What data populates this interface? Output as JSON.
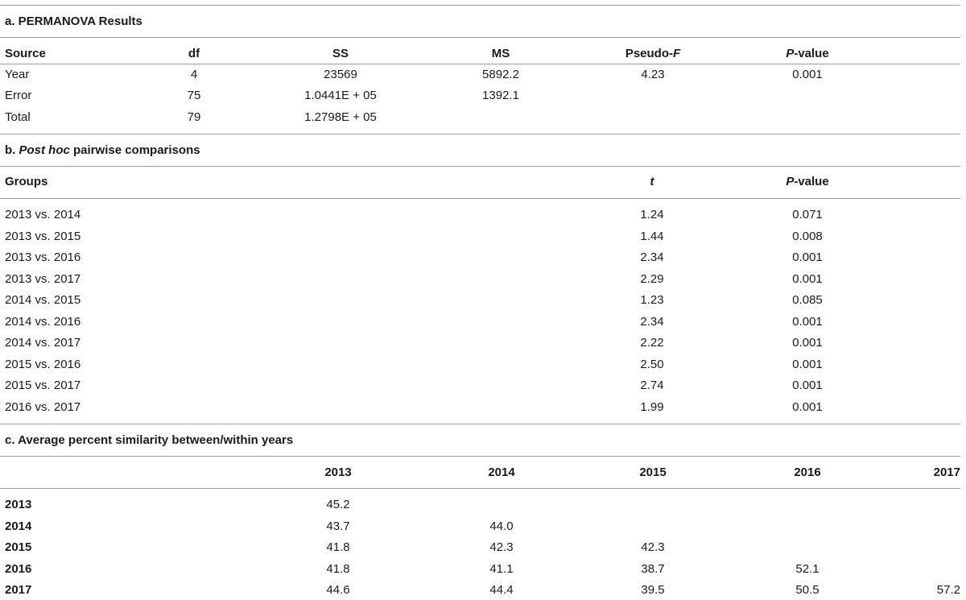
{
  "section_a": {
    "title": "a. PERMANOVA Results",
    "headers": {
      "source": "Source",
      "df": "df",
      "ss": "SS",
      "ms": "MS",
      "pseudo_f_prefix": "Pseudo-",
      "pseudo_f_italic": "F",
      "p_italic": "P",
      "p_suffix": "-value"
    },
    "rows": [
      {
        "source": "Year",
        "df": "4",
        "ss": "23569",
        "ms": "5892.2",
        "pseudo_f": "4.23",
        "p": "0.001"
      },
      {
        "source": "Error",
        "df": "75",
        "ss": "1.0441E + 05",
        "ms": "1392.1",
        "pseudo_f": "",
        "p": ""
      },
      {
        "source": "Total",
        "df": "79",
        "ss": "1.2798E + 05",
        "ms": "",
        "pseudo_f": "",
        "p": ""
      }
    ]
  },
  "section_b": {
    "title_prefix": "b. ",
    "title_italic": "Post hoc",
    "title_suffix": " pairwise comparisons",
    "headers": {
      "groups": "Groups",
      "t": "t",
      "p_italic": "P",
      "p_suffix": "-value"
    },
    "rows": [
      {
        "groups": "2013 vs. 2014",
        "t": "1.24",
        "p": "0.071"
      },
      {
        "groups": "2013 vs. 2015",
        "t": "1.44",
        "p": "0.008"
      },
      {
        "groups": "2013 vs. 2016",
        "t": "2.34",
        "p": "0.001"
      },
      {
        "groups": "2013 vs. 2017",
        "t": "2.29",
        "p": "0.001"
      },
      {
        "groups": "2014 vs. 2015",
        "t": "1.23",
        "p": "0.085"
      },
      {
        "groups": "2014 vs. 2016",
        "t": "2.34",
        "p": "0.001"
      },
      {
        "groups": "2014 vs. 2017",
        "t": "2.22",
        "p": "0.001"
      },
      {
        "groups": "2015 vs. 2016",
        "t": "2.50",
        "p": "0.001"
      },
      {
        "groups": "2015 vs. 2017",
        "t": "2.74",
        "p": "0.001"
      },
      {
        "groups": "2016 vs. 2017",
        "t": "1.99",
        "p": "0.001"
      }
    ]
  },
  "section_c": {
    "title": "c. Average percent similarity between/within years",
    "headers": [
      "2013",
      "2014",
      "2015",
      "2016",
      "2017"
    ],
    "rows": [
      {
        "label": "2013",
        "values": [
          "45.2",
          "",
          "",
          "",
          ""
        ]
      },
      {
        "label": "2014",
        "values": [
          "43.7",
          "44.0",
          "",
          "",
          ""
        ]
      },
      {
        "label": "2015",
        "values": [
          "41.8",
          "42.3",
          "42.3",
          "",
          ""
        ]
      },
      {
        "label": "2016",
        "values": [
          "41.8",
          "41.1",
          "38.7",
          "52.1",
          ""
        ]
      },
      {
        "label": "2017",
        "values": [
          "44.6",
          "44.4",
          "39.5",
          "50.5",
          "57.2"
        ]
      }
    ]
  }
}
